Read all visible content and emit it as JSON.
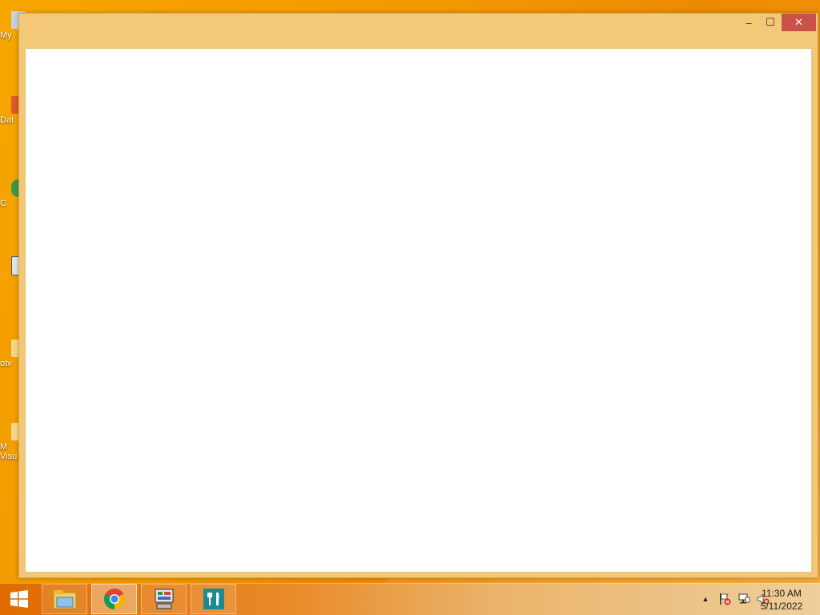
{
  "desktop": {
    "icons": [
      {
        "label": "My"
      },
      {
        "label": "Dat"
      },
      {
        "label": "C"
      },
      {
        "label": ""
      },
      {
        "label": "otv"
      },
      {
        "label": "M"
      },
      {
        "label": "Visu"
      }
    ]
  },
  "window": {
    "title": "",
    "buttons": {
      "minimize": "–",
      "maximize": "☐",
      "close": "✕"
    }
  },
  "taskbar": {
    "apps": [
      {
        "name": "file-explorer-icon"
      },
      {
        "name": "chrome-icon"
      },
      {
        "name": "control-panel-icon"
      },
      {
        "name": "restaurant-app-icon"
      }
    ],
    "tray": {
      "overflow": "▲",
      "time": "11:30 AM",
      "date": "5/11/2022"
    }
  },
  "colors": {
    "accent": "#f3c977",
    "close": "#c9524a",
    "desktop": "#f39a00"
  }
}
